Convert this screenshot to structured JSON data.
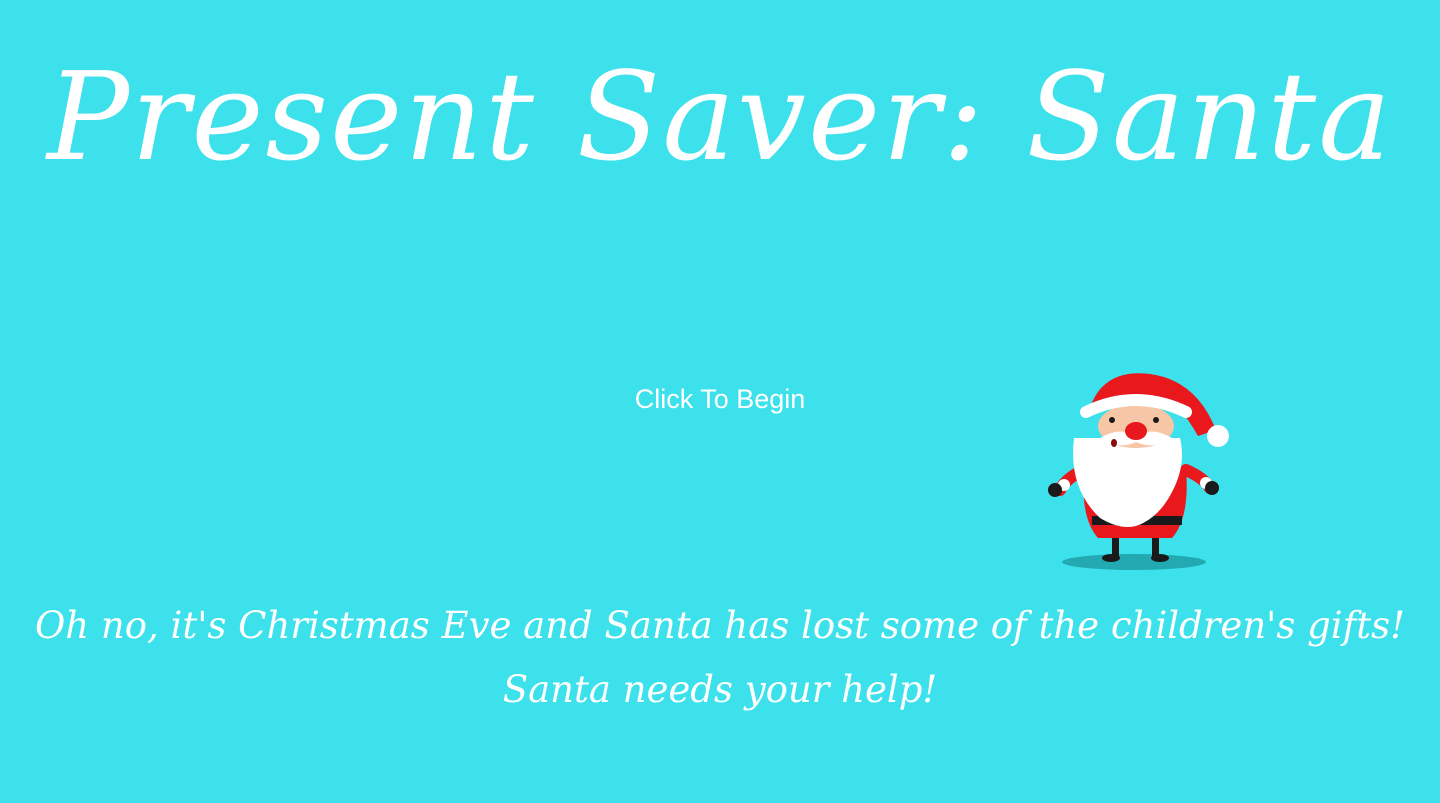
{
  "page": {
    "title": "Present Saver: Santa",
    "background_color": "#3de1ec"
  },
  "start": {
    "button_label": "Click To Begin"
  },
  "character": {
    "icon": "santa-claus-icon"
  },
  "story": {
    "line1": "Oh no, it's Christmas Eve and Santa has lost some of the children's gifts!",
    "line2": "Santa needs your help!"
  }
}
